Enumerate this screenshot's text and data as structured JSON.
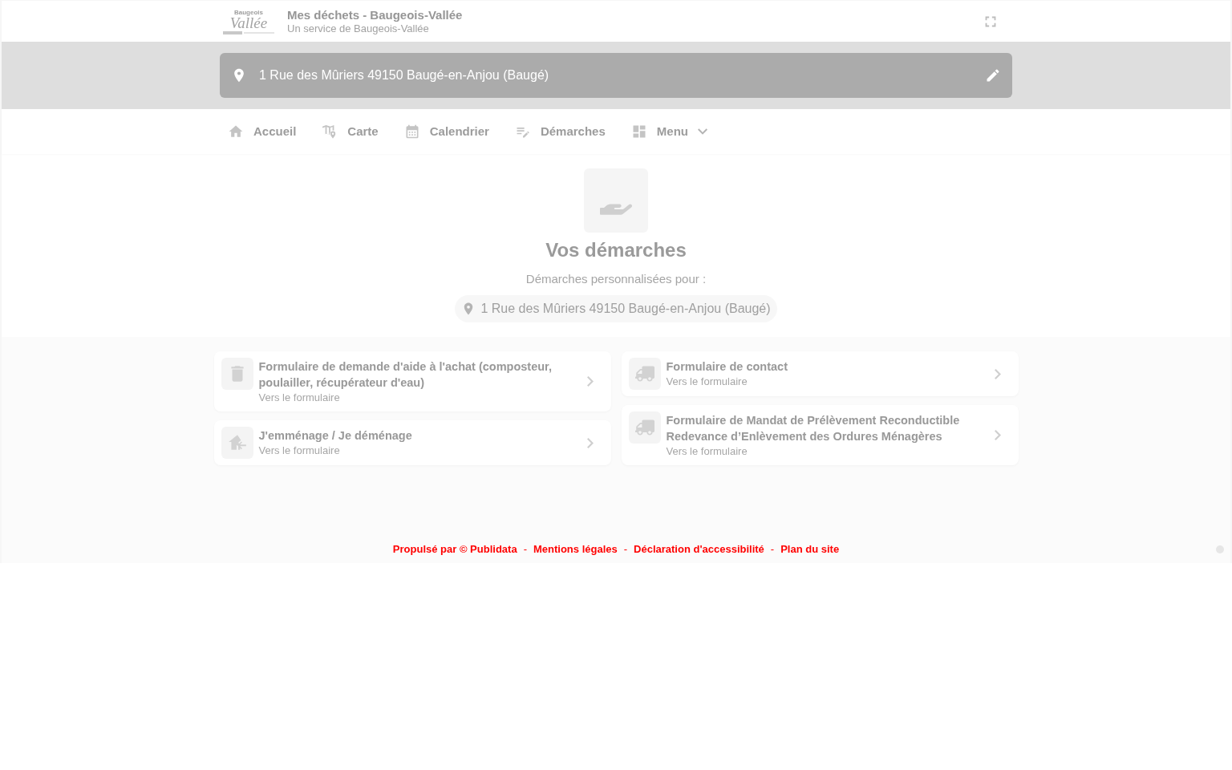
{
  "header": {
    "logo": {
      "top": "Baugeois",
      "script": "Vallée"
    },
    "title": "Mes déchets - Baugeois-Vallée",
    "subtitle": "Un service de Baugeois-Vallée"
  },
  "address_bar": {
    "value": "1 Rue des Mûriers 49150 Baugé-en-Anjou (Baugé)"
  },
  "nav": [
    {
      "kind": "home",
      "label": "Accueil"
    },
    {
      "kind": "map",
      "label": "Carte"
    },
    {
      "kind": "calendar",
      "label": "Calendrier"
    },
    {
      "kind": "procedures",
      "label": "Démarches"
    },
    {
      "kind": "menu",
      "label": "Menu",
      "expanded": false
    }
  ],
  "section": {
    "title": "Vos démarches",
    "subtitle": "Démarches personnalisées pour :",
    "address": "1 Rue des Mûriers 49150 Baugé-en-Anjou (Baugé)"
  },
  "columns": [
    {
      "cards": [
        {
          "kind": "bin",
          "title": "Formulaire de demande d'aide à l'achat (composteur, poulailler, récupérateur d'eau)",
          "link_text": "Vers le formulaire"
        },
        {
          "kind": "house",
          "title": "J'emménage / Je déménage",
          "link_text": "Vers le formulaire"
        }
      ]
    },
    {
      "cards": [
        {
          "kind": "truck",
          "title": "Formulaire de contact",
          "link_text": "Vers le formulaire"
        },
        {
          "kind": "truck",
          "title": "Formulaire de Mandat de Prélèvement Reconductible Redevance d’Enlèvement des Ordures Ménagères",
          "link_text": "Vers le formulaire"
        }
      ]
    }
  ],
  "footer": {
    "items": [
      {
        "kind": "link",
        "text": "Propulsé par © Publidata"
      },
      {
        "kind": "separator",
        "text": "-"
      },
      {
        "kind": "link",
        "text": "Mentions légales"
      },
      {
        "kind": "separator",
        "text": "-"
      },
      {
        "kind": "link",
        "text": "Déclaration d'accessibilité"
      },
      {
        "kind": "separator",
        "text": "-"
      },
      {
        "kind": "link",
        "text": "Plan du site"
      }
    ]
  }
}
